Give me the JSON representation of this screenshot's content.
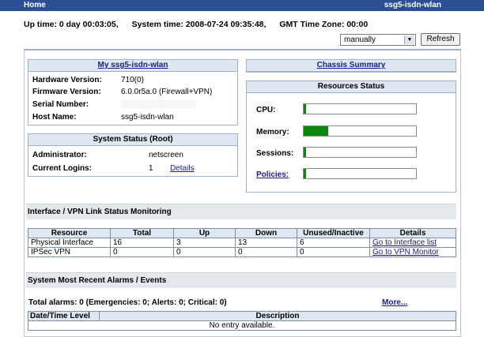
{
  "topbar": {
    "home": "Home",
    "device": "ssg5-isdn-wlan"
  },
  "status_line": {
    "uptime": "Up time: 0 day 00:03:05,",
    "system_time": "System time: 2008-07-24 09:35:48,",
    "gmt": "GMT Time Zone: 00:00"
  },
  "refresh": {
    "mode": "manually",
    "button": "Refresh"
  },
  "device_info": {
    "title": "My ssg5-isdn-wlan",
    "rows": [
      {
        "label": "Hardware Version:",
        "value": "710(0)"
      },
      {
        "label": "Firmware Version:",
        "value": "6.0.0r5a.0 (Firewall+VPN)"
      },
      {
        "label": "Serial Number:",
        "value": ""
      },
      {
        "label": "Host Name:",
        "value": "ssg5-isdn-wlan"
      }
    ]
  },
  "system_status": {
    "title": "System Status  (Root)",
    "administrator_label": "Administrator:",
    "administrator_value": "netscreen",
    "logins_label": "Current Logins:",
    "logins_value": "1",
    "details": "Details"
  },
  "chassis": {
    "link": "Chassis Summary"
  },
  "resources": {
    "title": "Resources Status",
    "items": [
      {
        "label": "CPU:",
        "level": 0.02
      },
      {
        "label": "Memory:",
        "level": 0.22
      },
      {
        "label": "Sessions:",
        "level": 0.02
      },
      {
        "label": "Policies:",
        "level": 0.02
      }
    ]
  },
  "interface_section": {
    "title": "Interface / VPN Link Status Monitoring",
    "headers": [
      "Resource",
      "Total",
      "Up",
      "Down",
      "Unused/Inactive",
      "Details"
    ],
    "rows": [
      [
        "Physical Interface",
        "16",
        "3",
        "13",
        "6",
        "Go to Interface list"
      ],
      [
        "IPSec VPN",
        "0",
        "0",
        "0",
        "0",
        "Go to VPN Monitor"
      ]
    ]
  },
  "alarms": {
    "title": "System Most Recent Alarms   /   Events",
    "totals": "Total alarms: 0   (Emergencies: 0; Alerts: 0; Critical: 0)",
    "more": "More...",
    "col_datetime": "Date/Time Level",
    "col_description": "Description",
    "empty": "No entry available."
  },
  "colors": {
    "topbar": "#2a4f95",
    "bar": "#0a8a0a",
    "header_bg": "#dfe7f3"
  }
}
